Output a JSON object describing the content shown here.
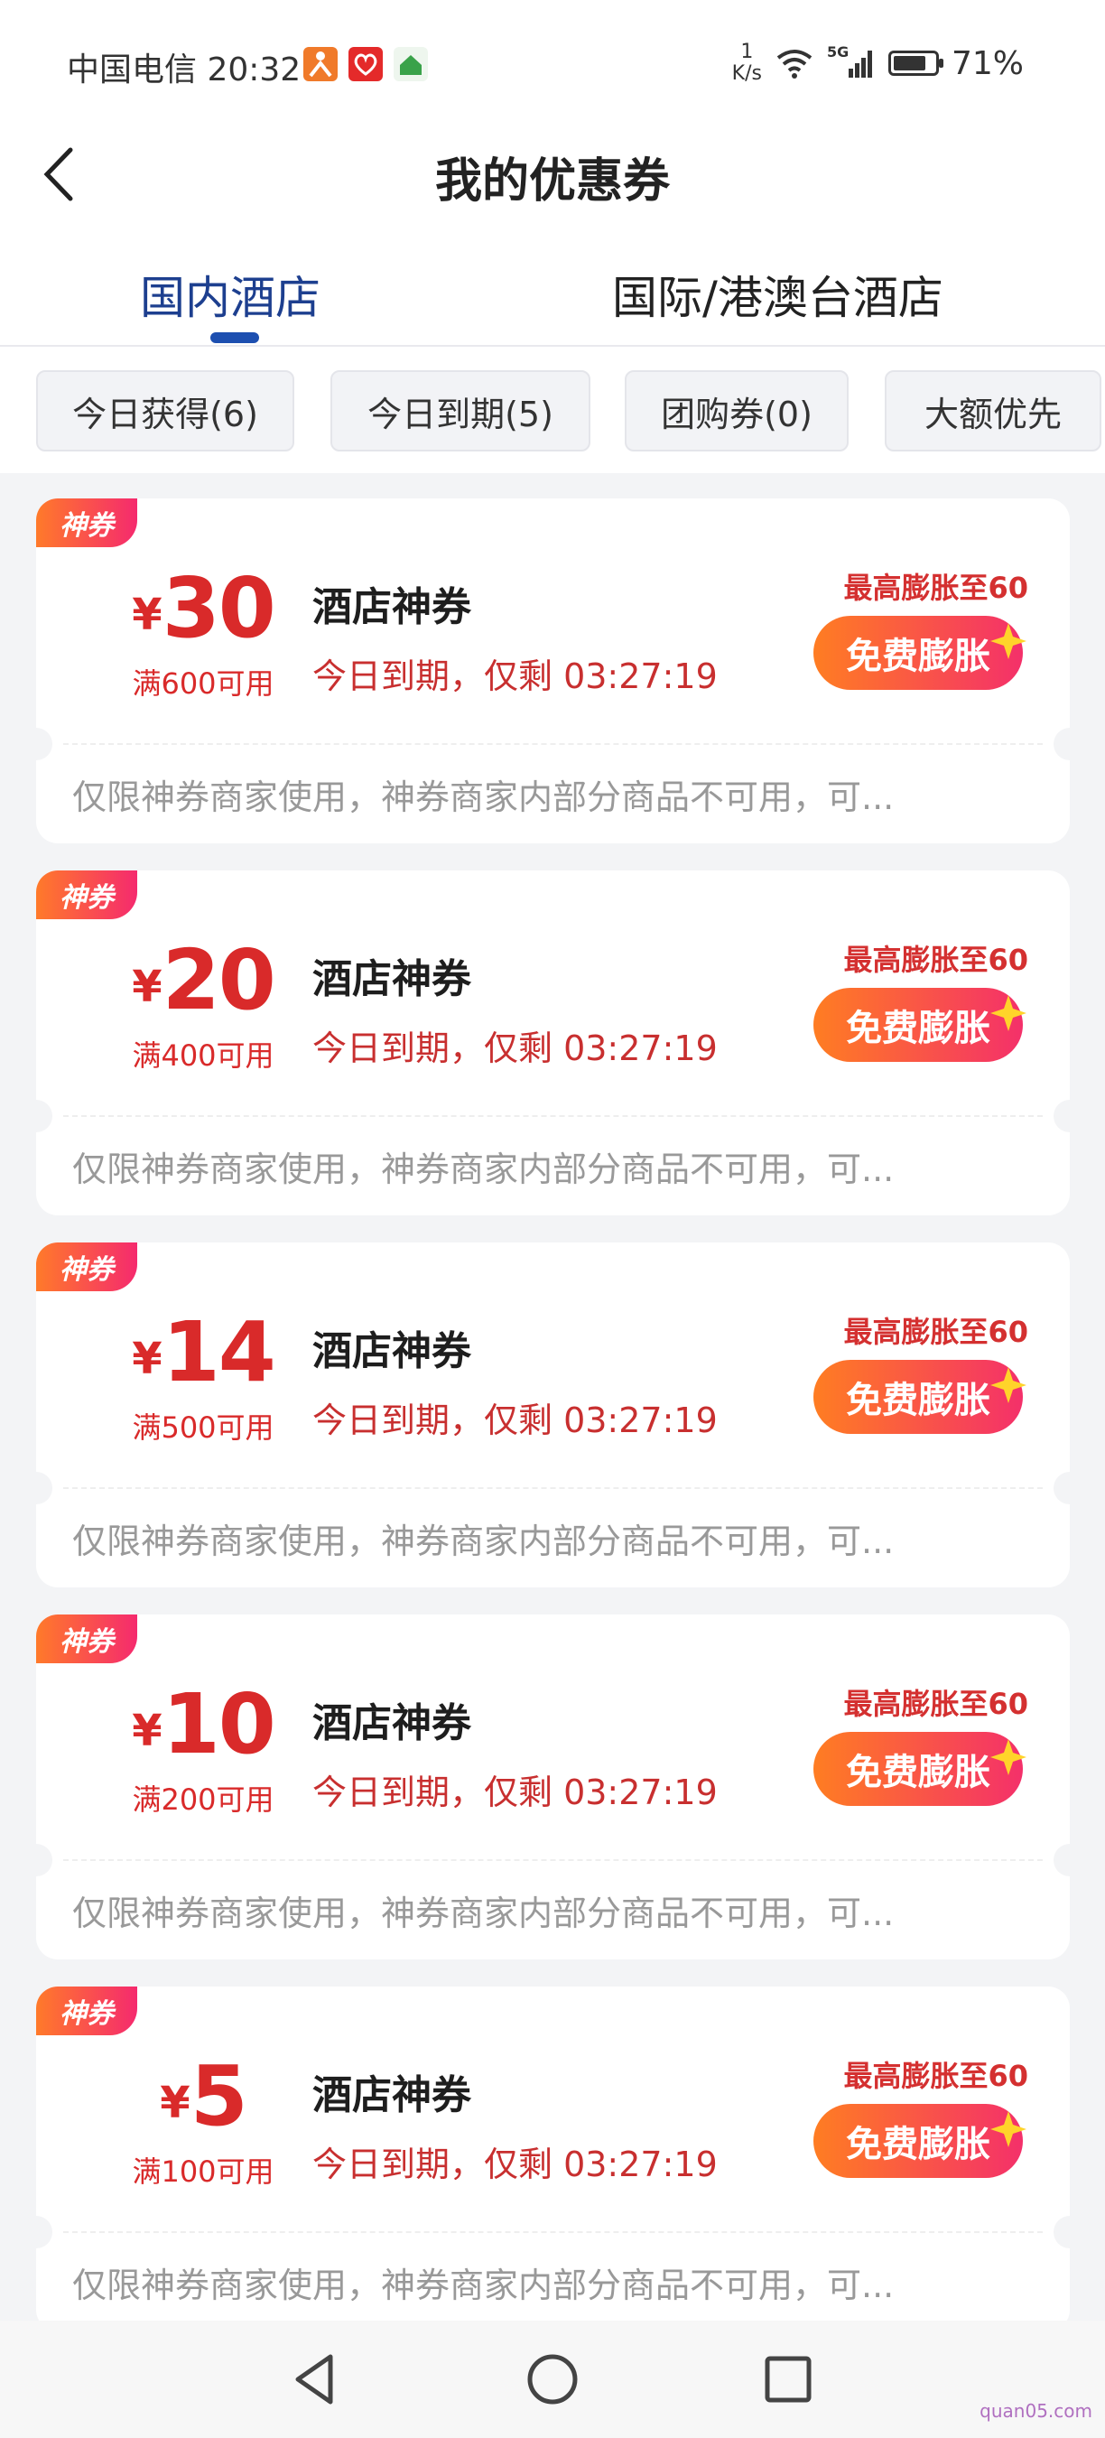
{
  "status_bar": {
    "carrier_time": "中国电信 20:32",
    "speed_value": "1",
    "speed_unit": "K/s",
    "battery": "71%",
    "network": "5G",
    "icons": [
      "app-figure-icon",
      "app-heart-icon",
      "app-house-icon",
      "wifi-icon",
      "signal-icon",
      "battery-icon"
    ]
  },
  "header": {
    "title": "我的优惠券",
    "back_icon": "chevron-left-icon"
  },
  "tabs": [
    {
      "label": "国内酒店",
      "active": true
    },
    {
      "label": "国际/港澳台酒店",
      "active": false
    }
  ],
  "filters": [
    {
      "label": "今日获得(6)"
    },
    {
      "label": "今日到期(5)"
    },
    {
      "label": "团购券(0)"
    },
    {
      "label": "大额优先"
    }
  ],
  "coupons": [
    {
      "tag": "神券",
      "currency": "¥",
      "amount": "30",
      "condition": "满600可用",
      "title": "酒店神券",
      "expire": "今日到期，仅剩 03:27:19",
      "max_note": "最高膨胀至60",
      "button": "免费膨胀",
      "desc": "仅限神券商家使用，神券商家内部分商品不可用，可..."
    },
    {
      "tag": "神券",
      "currency": "¥",
      "amount": "20",
      "condition": "满400可用",
      "title": "酒店神券",
      "expire": "今日到期，仅剩 03:27:19",
      "max_note": "最高膨胀至60",
      "button": "免费膨胀",
      "desc": "仅限神券商家使用，神券商家内部分商品不可用，可..."
    },
    {
      "tag": "神券",
      "currency": "¥",
      "amount": "14",
      "condition": "满500可用",
      "title": "酒店神券",
      "expire": "今日到期，仅剩 03:27:19",
      "max_note": "最高膨胀至60",
      "button": "免费膨胀",
      "desc": "仅限神券商家使用，神券商家内部分商品不可用，可..."
    },
    {
      "tag": "神券",
      "currency": "¥",
      "amount": "10",
      "condition": "满200可用",
      "title": "酒店神券",
      "expire": "今日到期，仅剩 03:27:19",
      "max_note": "最高膨胀至60",
      "button": "免费膨胀",
      "desc": "仅限神券商家使用，神券商家内部分商品不可用，可..."
    },
    {
      "tag": "神券",
      "currency": "¥",
      "amount": "5",
      "condition": "满100可用",
      "title": "酒店神券",
      "expire": "今日到期，仅剩 03:27:19",
      "max_note": "最高膨胀至60",
      "button": "免费膨胀",
      "desc": "仅限神券商家使用，神券商家内部分商品不可用，可..."
    }
  ],
  "nav": {
    "icons": [
      "nav-back-icon",
      "nav-home-icon",
      "nav-recents-icon"
    ]
  },
  "watermark": "quan05.com",
  "colors": {
    "accent_blue": "#1d4fb0",
    "coupon_red": "#d92a2a",
    "button_orange": "#ff7d22",
    "button_pink": "#f4306a"
  }
}
